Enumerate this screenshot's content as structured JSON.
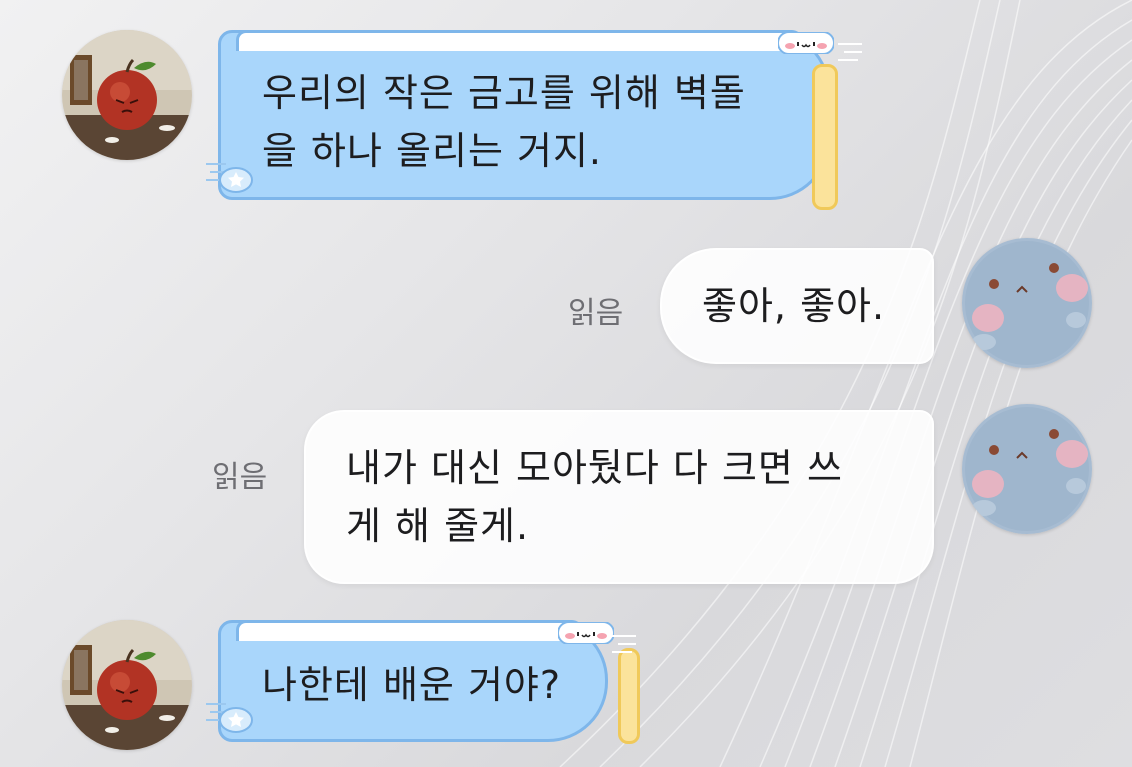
{
  "messages": [
    {
      "side": "incoming",
      "text_lines": [
        "우리의 작은 금고를 위해 벽돌",
        "을 하나 올리는 거지."
      ]
    },
    {
      "side": "outgoing",
      "status": "읽음",
      "text": "좋아, 좋아."
    },
    {
      "side": "outgoing",
      "status": "읽음",
      "text_lines": [
        "내가 대신 모아뒀다 다 크면 쓰",
        "게 해 줄게."
      ]
    },
    {
      "side": "incoming",
      "text": "나한테 배운 거야?"
    }
  ],
  "colors": {
    "incoming_bubble": "#a9d6fb",
    "incoming_border": "#7eb6ea",
    "outgoing_bubble": "#ffffff",
    "read_status": "#6e6e73"
  },
  "icons": {
    "incoming_avatar": "apple-character-avatar",
    "outgoing_avatar": "blue-plush-avatar",
    "bubble_face": "kawaii-face-icon",
    "bubble_star": "star-icon"
  }
}
